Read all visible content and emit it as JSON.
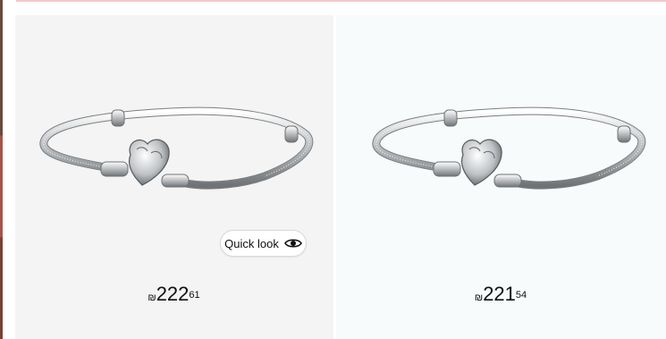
{
  "products": [
    {
      "image_alt": "silver snake chain bracelet with heart clasp",
      "quick_look_label": "Quick look",
      "price": {
        "currency": "₪",
        "whole": "222",
        "fraction": "61"
      }
    },
    {
      "image_alt": "silver snake chain bracelet with heart clasp",
      "price": {
        "currency": "₪",
        "whole": "221",
        "fraction": "54"
      }
    }
  ],
  "icons": {
    "quick_look": "eye-icon"
  },
  "colors": {
    "card_bg_1": "#f4f4f4",
    "card_bg_2": "#f7fbfb",
    "top_rule": "#f3c9cc",
    "text": "#0f1111"
  }
}
